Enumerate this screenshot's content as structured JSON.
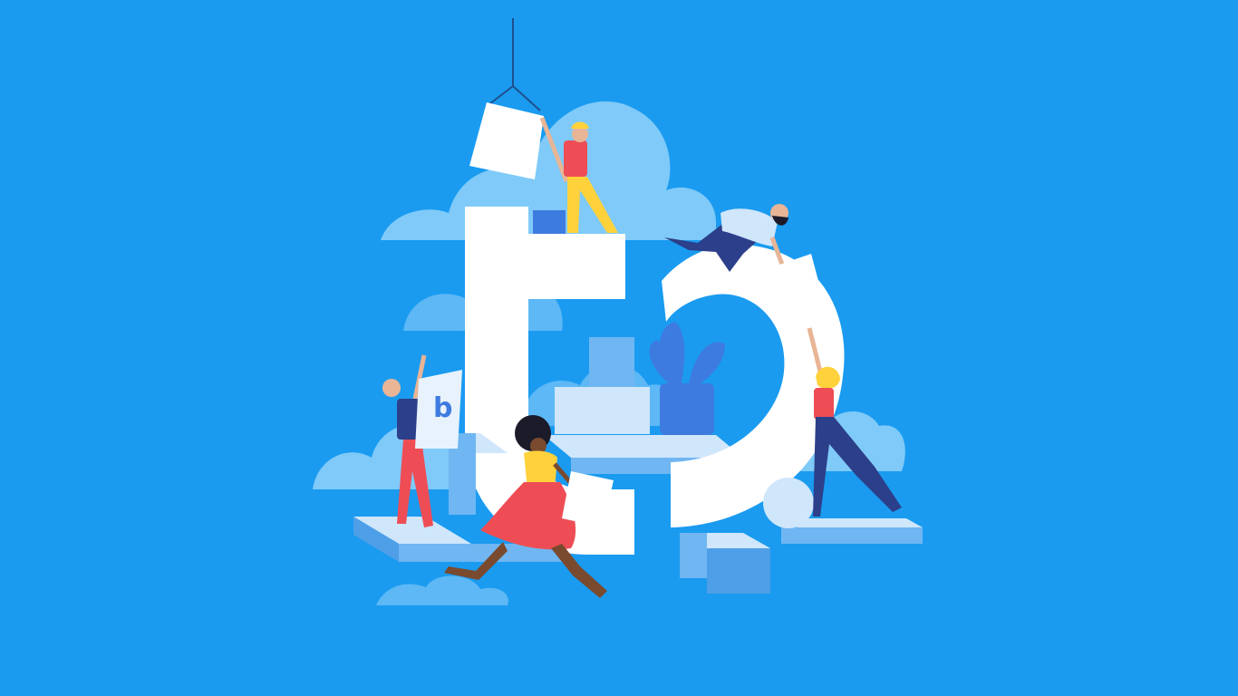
{
  "illustration": {
    "subject": "team-building-logo-mark",
    "mark_letters": [
      "t",
      "b"
    ],
    "blueprint_glyph": "b",
    "figure_count": 5
  },
  "colors": {
    "background": "#1a9bf0",
    "cloud_light": "#7fcaf8",
    "cloud_mid": "#5db8f5",
    "logo_white": "#ffffff",
    "block_top": "#cfe6fb",
    "block_side": "#6fb6f2",
    "block_dark": "#4f9fe8",
    "skin": "#e8b596",
    "skin_dark": "#7a4a2f",
    "red": "#ee4d55",
    "yellow": "#ffd23c",
    "navy": "#2c3f8a",
    "plant": "#3e7be0"
  }
}
